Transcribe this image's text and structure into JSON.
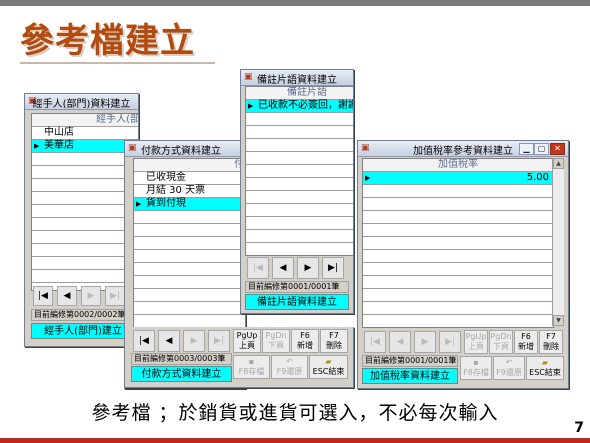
{
  "slide": {
    "title": "參考檔建立",
    "footer": "參考檔 ；於銷貨或進貨可選入，不必每次輸入",
    "page_number": "7"
  },
  "colors": {
    "title": "#b34a0e",
    "selection": "#00ffff",
    "bottom_bar": "#c0281e"
  },
  "nav": {
    "first": "|◀",
    "prev": "◀",
    "next": "▶",
    "last": "▶|"
  },
  "win_handler": {
    "title": "經手人(部門)資料建立",
    "header": "經手人(部門)",
    "rows": [
      "中山店",
      "美華店"
    ],
    "status": "目前編修第0002/0002筆",
    "caption": "經手人(部門)建立"
  },
  "win_payment": {
    "title": "付款方式資料建立",
    "header": "付款",
    "rows": [
      "已收現金",
      "月結 30 天票",
      "貨到付現"
    ],
    "status": "目前編修第0003/0003筆",
    "caption": "付款方式資料建立",
    "buttons": {
      "pgup_top": "PgUp",
      "pgup_bottom": "上頁",
      "pgdn_top": "PgDn",
      "pgdn_bottom": "下頁",
      "f6_top": "F6",
      "f6_bottom": "新增",
      "f7_top": "F7",
      "f7_bottom": "刪除",
      "f8": "F8存檔",
      "f9": "F9還原",
      "esc": "ESC結束"
    }
  },
  "win_memo": {
    "title": "備註片語資料建立",
    "header": "備註片語",
    "rows": [
      "已收款不必簽回，謝謝！"
    ],
    "status": "目前編修第0001/0001筆",
    "caption": "備註片語資料建立"
  },
  "win_tax": {
    "title": "加值稅率參考資料建立",
    "header": "加值稅率",
    "rows": [
      "5.00"
    ],
    "status": "目前編修第0001/0001筆",
    "caption": "加值稅率資料建立",
    "buttons": {
      "pgup_top": "PgUp",
      "pgup_bottom": "上頁",
      "pgdn_top": "PgDn",
      "pgdn_bottom": "下頁",
      "f6_top": "F6",
      "f6_bottom": "新增",
      "f7_top": "F7",
      "f7_bottom": "刪除",
      "f8": "F8存檔",
      "f9": "F9還原",
      "esc": "ESC結束"
    }
  }
}
